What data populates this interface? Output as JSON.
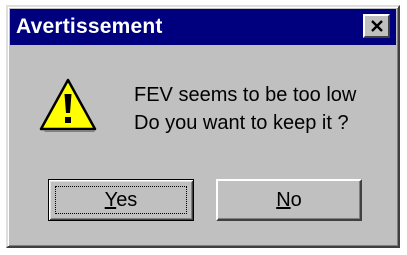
{
  "dialog": {
    "title": "Avertissement",
    "close_icon": "close-icon",
    "icon": "warning-icon",
    "message_line1": "FEV seems to be too low",
    "message_line2": "Do you want to keep it ?",
    "buttons": {
      "yes_mnemonic": "Y",
      "yes_rest": "es",
      "no_mnemonic": "N",
      "no_rest": "o"
    },
    "colors": {
      "titlebar": "#00007f",
      "face": "#c0c0c0",
      "warning_fill": "#ffff00"
    }
  }
}
